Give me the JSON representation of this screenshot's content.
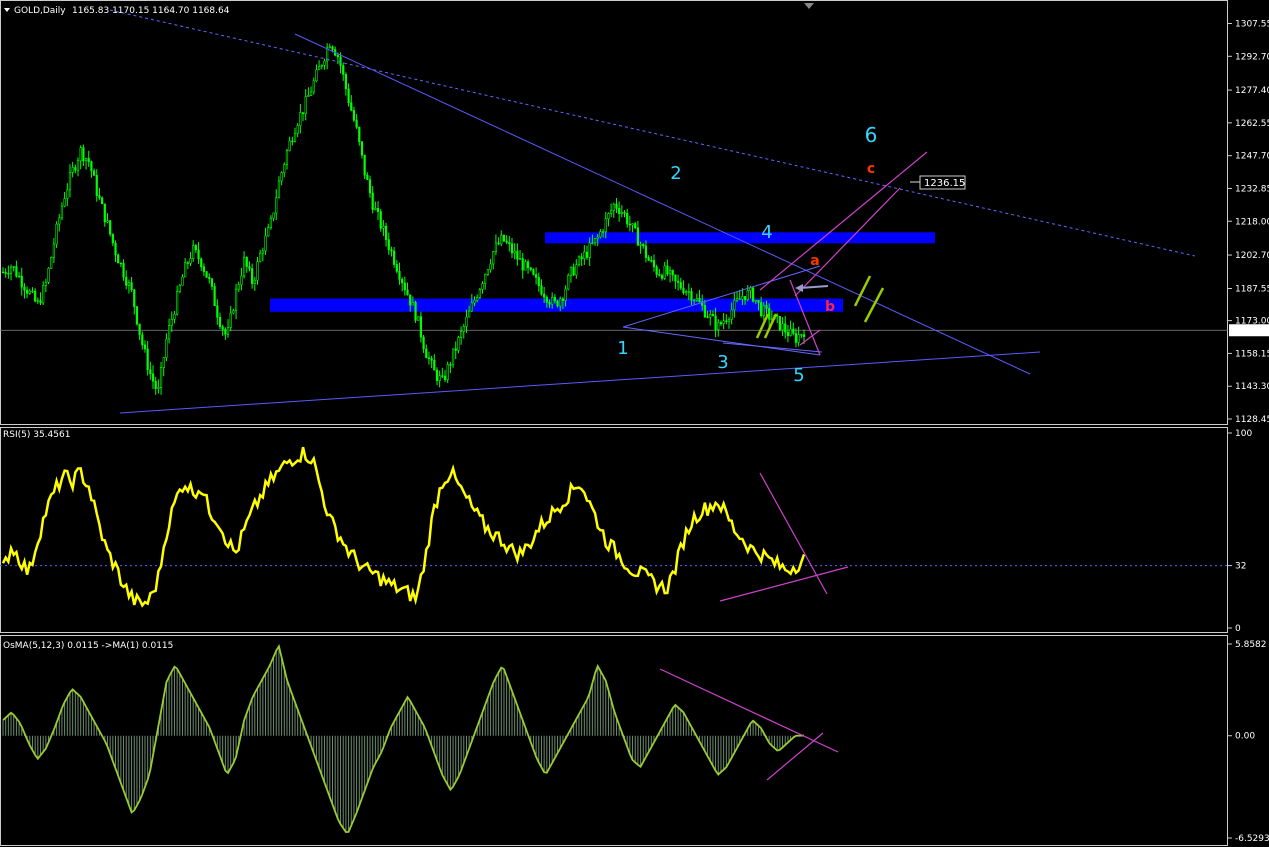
{
  "window": {
    "symbol": "GOLD,Daily",
    "ohlc": "1165.83 1170.15 1164.70 1168.64"
  },
  "price_pane": {
    "ticks": [
      "1307.55",
      "1292.70",
      "1277.40",
      "1262.55",
      "1247.70",
      "1232.85",
      "1218.00",
      "1202.70",
      "1187.55",
      "1173.00",
      "1158.15",
      "1143.30",
      "1128.45"
    ],
    "current_price": "1168.64",
    "target_label": "1236.15",
    "wave_labels": [
      "1",
      "2",
      "3",
      "4",
      "5",
      "6"
    ],
    "corrective_labels": [
      "a",
      "b",
      "c"
    ],
    "colors": {
      "candles": "#00ff00",
      "zones": "#0000ff",
      "trendlines": "#6666ff",
      "waves": "#33d6ff",
      "abc": "#ff3300",
      "b_label": "#ff2244",
      "channel": "#cc44cc",
      "marks": "#99cc00"
    }
  },
  "rsi_pane": {
    "title": "RSI(5) 35.4561",
    "ticks": [
      "100",
      "32",
      "0"
    ],
    "level": 32,
    "current": 35.4561,
    "color": "#ffff00"
  },
  "osma_pane": {
    "title": "OsMA(5,12,3) 0.0115  ->MA(1) 0.0115",
    "ticks": [
      "5.8582",
      "0.00",
      "-6.5293"
    ],
    "current": 0.0115,
    "color": "#99cc33"
  },
  "chart_data": [
    {
      "type": "candlestick",
      "title": "GOLD,Daily",
      "ylim": [
        1128.45,
        1307.55
      ],
      "close": [
        1195,
        1198,
        1192,
        1186,
        1180,
        1190,
        1210,
        1228,
        1240,
        1250,
        1245,
        1230,
        1218,
        1205,
        1195,
        1185,
        1165,
        1150,
        1140,
        1165,
        1180,
        1195,
        1205,
        1200,
        1190,
        1175,
        1165,
        1185,
        1200,
        1190,
        1205,
        1215,
        1235,
        1250,
        1262,
        1270,
        1280,
        1290,
        1300,
        1292,
        1275,
        1260,
        1240,
        1225,
        1215,
        1205,
        1195,
        1185,
        1175,
        1160,
        1150,
        1145,
        1155,
        1165,
        1175,
        1185,
        1195,
        1205,
        1210,
        1205,
        1200,
        1195,
        1190,
        1185,
        1180,
        1185,
        1195,
        1200,
        1205,
        1210,
        1218,
        1226,
        1222,
        1215,
        1208,
        1200,
        1195,
        1195,
        1190,
        1188,
        1185,
        1180,
        1175,
        1170,
        1175,
        1180,
        1185,
        1185,
        1178,
        1175,
        1172,
        1168,
        1165,
        1168.64
      ],
      "current": 1168.64,
      "annotation": "1236.15"
    },
    {
      "type": "line",
      "title": "RSI(5) 35.4561",
      "ylim": [
        0,
        100
      ],
      "level": 32,
      "values": [
        30,
        42,
        35,
        28,
        45,
        60,
        70,
        78,
        75,
        80,
        72,
        55,
        40,
        32,
        22,
        15,
        12,
        14,
        25,
        50,
        65,
        75,
        70,
        72,
        60,
        55,
        45,
        38,
        50,
        60,
        68,
        75,
        80,
        85,
        88,
        90,
        86,
        70,
        55,
        48,
        40,
        35,
        30,
        28,
        25,
        22,
        20,
        18,
        15,
        35,
        60,
        75,
        80,
        72,
        65,
        58,
        52,
        48,
        45,
        40,
        38,
        42,
        50,
        55,
        60,
        65,
        70,
        75,
        65,
        55,
        45,
        40,
        35,
        30,
        28,
        25,
        22,
        20,
        30,
        45,
        55,
        60,
        62,
        65,
        58,
        50,
        45,
        40,
        38,
        35,
        32,
        30,
        32,
        35.4561
      ]
    },
    {
      "type": "bar",
      "title": "OsMA(5,12,3) 0.0115  ->MA(1) 0.0115",
      "ylim": [
        -6.5293,
        5.8582
      ],
      "values": [
        1.0,
        1.5,
        0.8,
        -0.5,
        -1.5,
        -0.8,
        0.5,
        2.0,
        3.0,
        2.5,
        1.5,
        0.5,
        -0.5,
        -2.0,
        -3.5,
        -5.0,
        -4.0,
        -2.5,
        0.5,
        3.5,
        4.5,
        3.5,
        2.5,
        1.5,
        0.5,
        -1.0,
        -2.5,
        -1.5,
        1.0,
        2.5,
        3.5,
        4.5,
        5.8,
        3.5,
        2.0,
        0.5,
        -1.0,
        -2.5,
        -4.0,
        -5.5,
        -6.3,
        -5.0,
        -3.5,
        -2.0,
        -1.0,
        0.5,
        1.5,
        2.5,
        1.5,
        0.5,
        -1.0,
        -2.5,
        -3.5,
        -2.5,
        -1.0,
        0.5,
        2.0,
        3.5,
        4.5,
        3.0,
        1.5,
        0.0,
        -1.5,
        -2.5,
        -1.5,
        -0.5,
        0.5,
        1.5,
        2.5,
        4.5,
        3.5,
        1.5,
        0.0,
        -1.5,
        -2.0,
        -1.0,
        0.0,
        1.0,
        2.0,
        1.5,
        0.5,
        -0.5,
        -1.5,
        -2.5,
        -2.0,
        -1.0,
        0.0,
        1.0,
        0.5,
        -0.5,
        -1.0,
        -0.5,
        0.0,
        0.0115
      ]
    }
  ]
}
